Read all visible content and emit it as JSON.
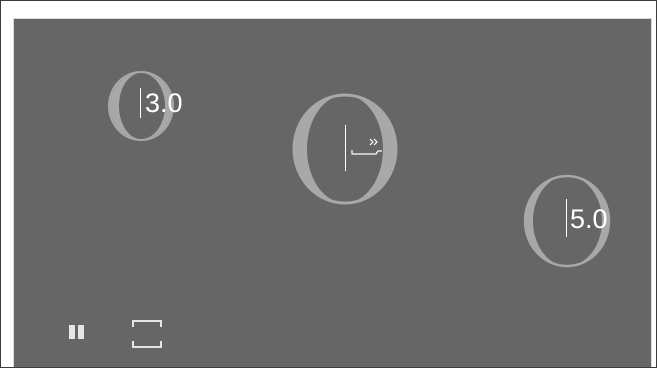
{
  "knobs": [
    {
      "name": "knob-left",
      "value": "3.0"
    },
    {
      "name": "knob-center",
      "value": "",
      "icon": "skip-forward-arrow-icon"
    },
    {
      "name": "knob-right",
      "value": "5.0"
    }
  ],
  "controls": {
    "pause_icon": "pause-icon",
    "fullscreen_icon": "fullscreen-icon"
  },
  "colors": {
    "background": "#666666",
    "ring": "#a8a8a8",
    "text": "#ffffff"
  }
}
